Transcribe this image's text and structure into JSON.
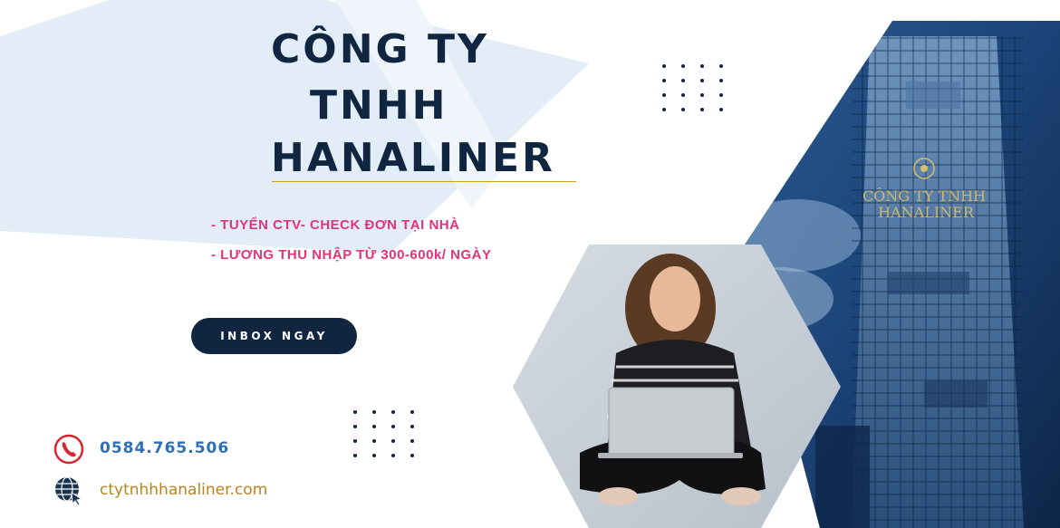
{
  "company": {
    "title_lines": [
      "CÔNG TY",
      "TNHH",
      "HANALINER"
    ]
  },
  "bullets": [
    "- TUYỂN CTV- CHECK ĐƠN TẠI NHÀ",
    "- LƯƠNG THU NHẬP TỪ 300-600k/ NGÀY"
  ],
  "cta": {
    "label": "INBOX NGAY"
  },
  "contact": {
    "phone": "0584.765.506",
    "website": "ctytnhhhanaliner.com"
  },
  "building_sign": [
    "CÔNG TY TNHH",
    "HANALINER"
  ],
  "icons": {
    "phone": "phone-icon",
    "web": "globe-cursor-icon"
  },
  "colors": {
    "navy": "#0f2540",
    "pink": "#e0347a",
    "gold": "#c9a227",
    "phone_blue": "#2f6fb3",
    "light_blue_bg": "#dfeaf6"
  }
}
